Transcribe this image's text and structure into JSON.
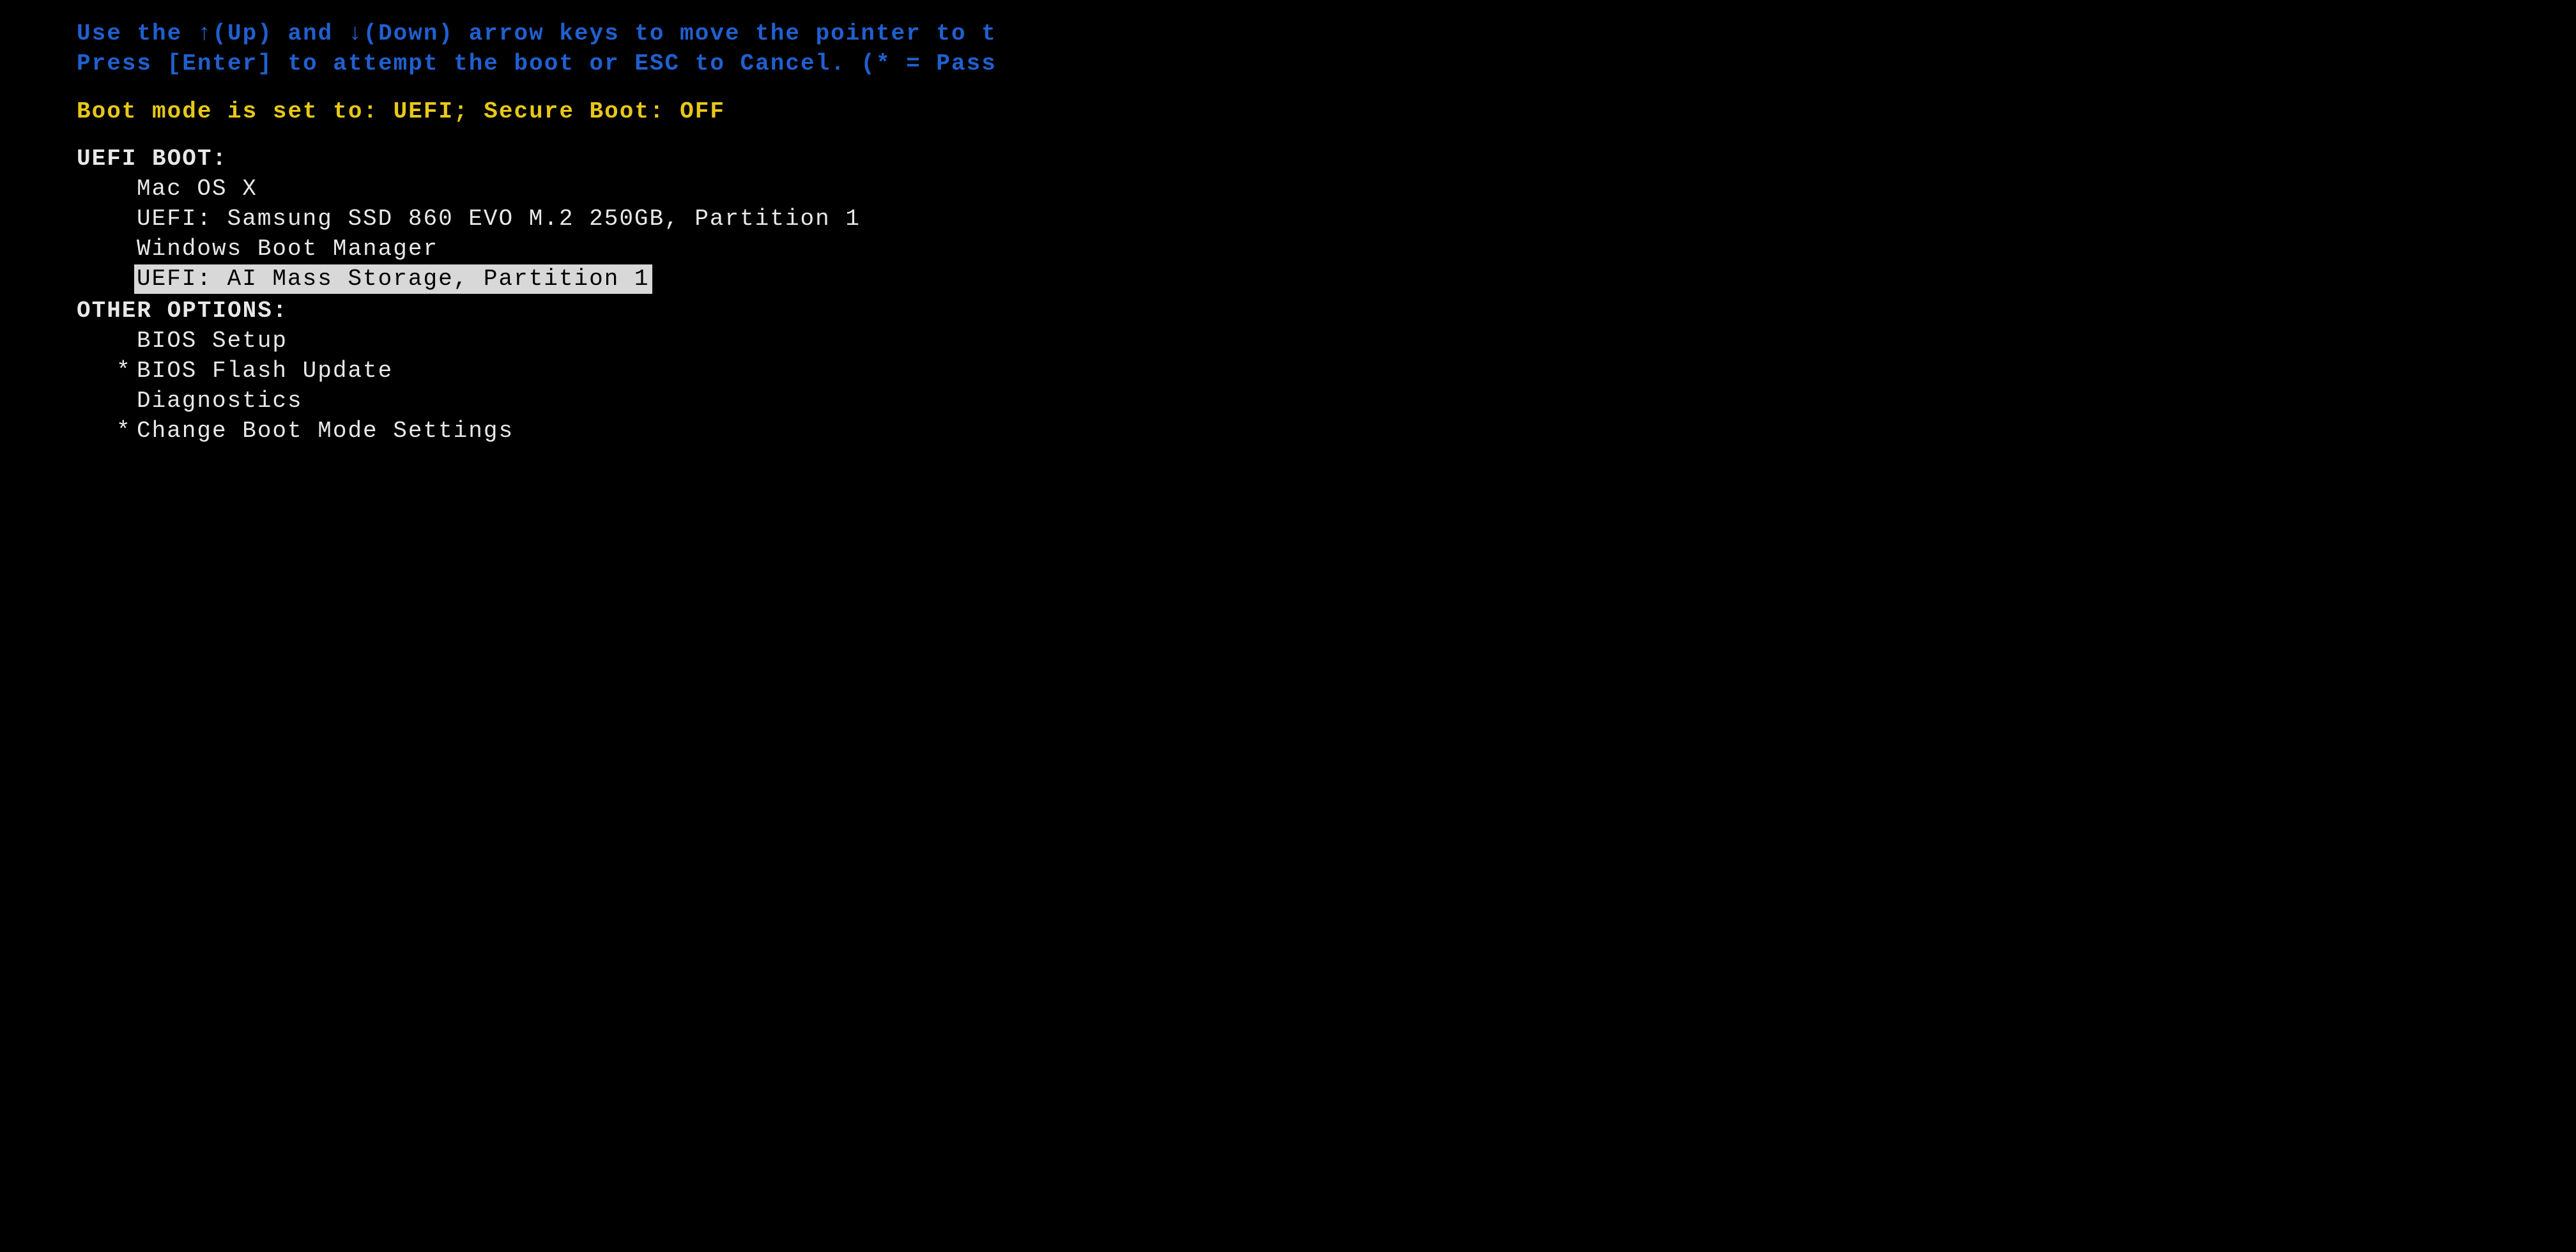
{
  "help": {
    "line1": "Use the ↑(Up) and ↓(Down) arrow keys to move the pointer to t",
    "line2": "Press [Enter] to attempt the boot or ESC to Cancel. (* = Pass"
  },
  "status": "Boot mode is set to: UEFI; Secure Boot: OFF",
  "sections": {
    "uefi_boot": {
      "heading": "UEFI BOOT:",
      "items": [
        {
          "label": "Mac OS X",
          "selected": false,
          "password": false
        },
        {
          "label": "UEFI: Samsung SSD 860 EVO M.2 250GB, Partition 1",
          "selected": false,
          "password": false
        },
        {
          "label": "Windows Boot Manager",
          "selected": false,
          "password": false
        },
        {
          "label": "UEFI: AI Mass Storage, Partition 1",
          "selected": true,
          "password": false
        }
      ]
    },
    "other_options": {
      "heading": "OTHER OPTIONS:",
      "items": [
        {
          "label": "BIOS Setup",
          "selected": false,
          "password": false
        },
        {
          "label": "BIOS Flash Update",
          "selected": false,
          "password": true
        },
        {
          "label": "Diagnostics",
          "selected": false,
          "password": false
        },
        {
          "label": "Change Boot Mode Settings",
          "selected": false,
          "password": true
        }
      ]
    }
  },
  "password_marker": "*"
}
